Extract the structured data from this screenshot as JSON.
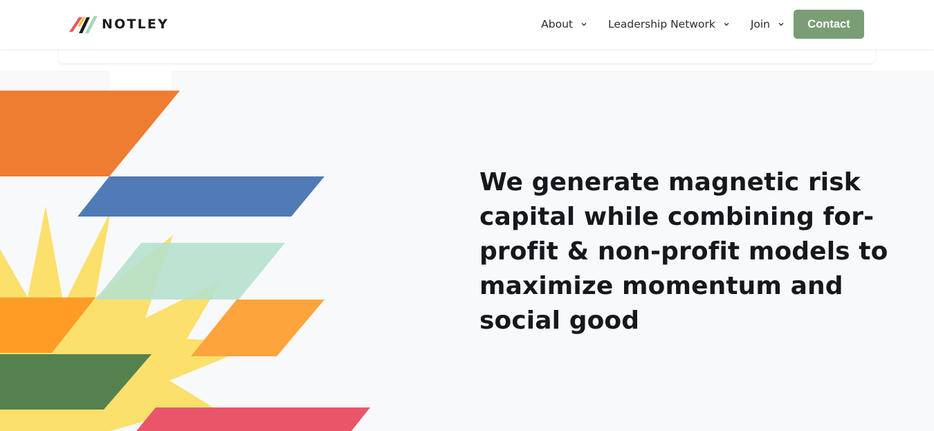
{
  "brand": {
    "name": "NOTLEY",
    "logo_icon": "notley-logo-icon",
    "colors": {
      "coral": "#e85566",
      "yellow": "#f4c431",
      "black": "#1b1b1b",
      "mint": "#9fd6bb"
    }
  },
  "nav": {
    "items": [
      {
        "label": "About",
        "icon": "chevron-down-icon"
      },
      {
        "label": "Leadership Network",
        "icon": "chevron-down-icon"
      },
      {
        "label": "Join",
        "icon": "chevron-down-icon"
      }
    ],
    "contact_label": "Contact"
  },
  "hero": {
    "headline": "We generate magnetic risk capital while combining for-profit & non-profit models to maximize momentum and social good"
  },
  "colors": {
    "accent_green": "#7a9d76",
    "page_bg": "#f8f9fa",
    "text_dark": "#15181d",
    "art_orange": "#ee7c31",
    "art_blue": "#507bb7",
    "art_mint": "#b6e1cd",
    "art_yellow": "#fbe06c",
    "art_light_orange": "#fea43c",
    "art_green": "#55814f",
    "art_red": "#e9566a"
  }
}
